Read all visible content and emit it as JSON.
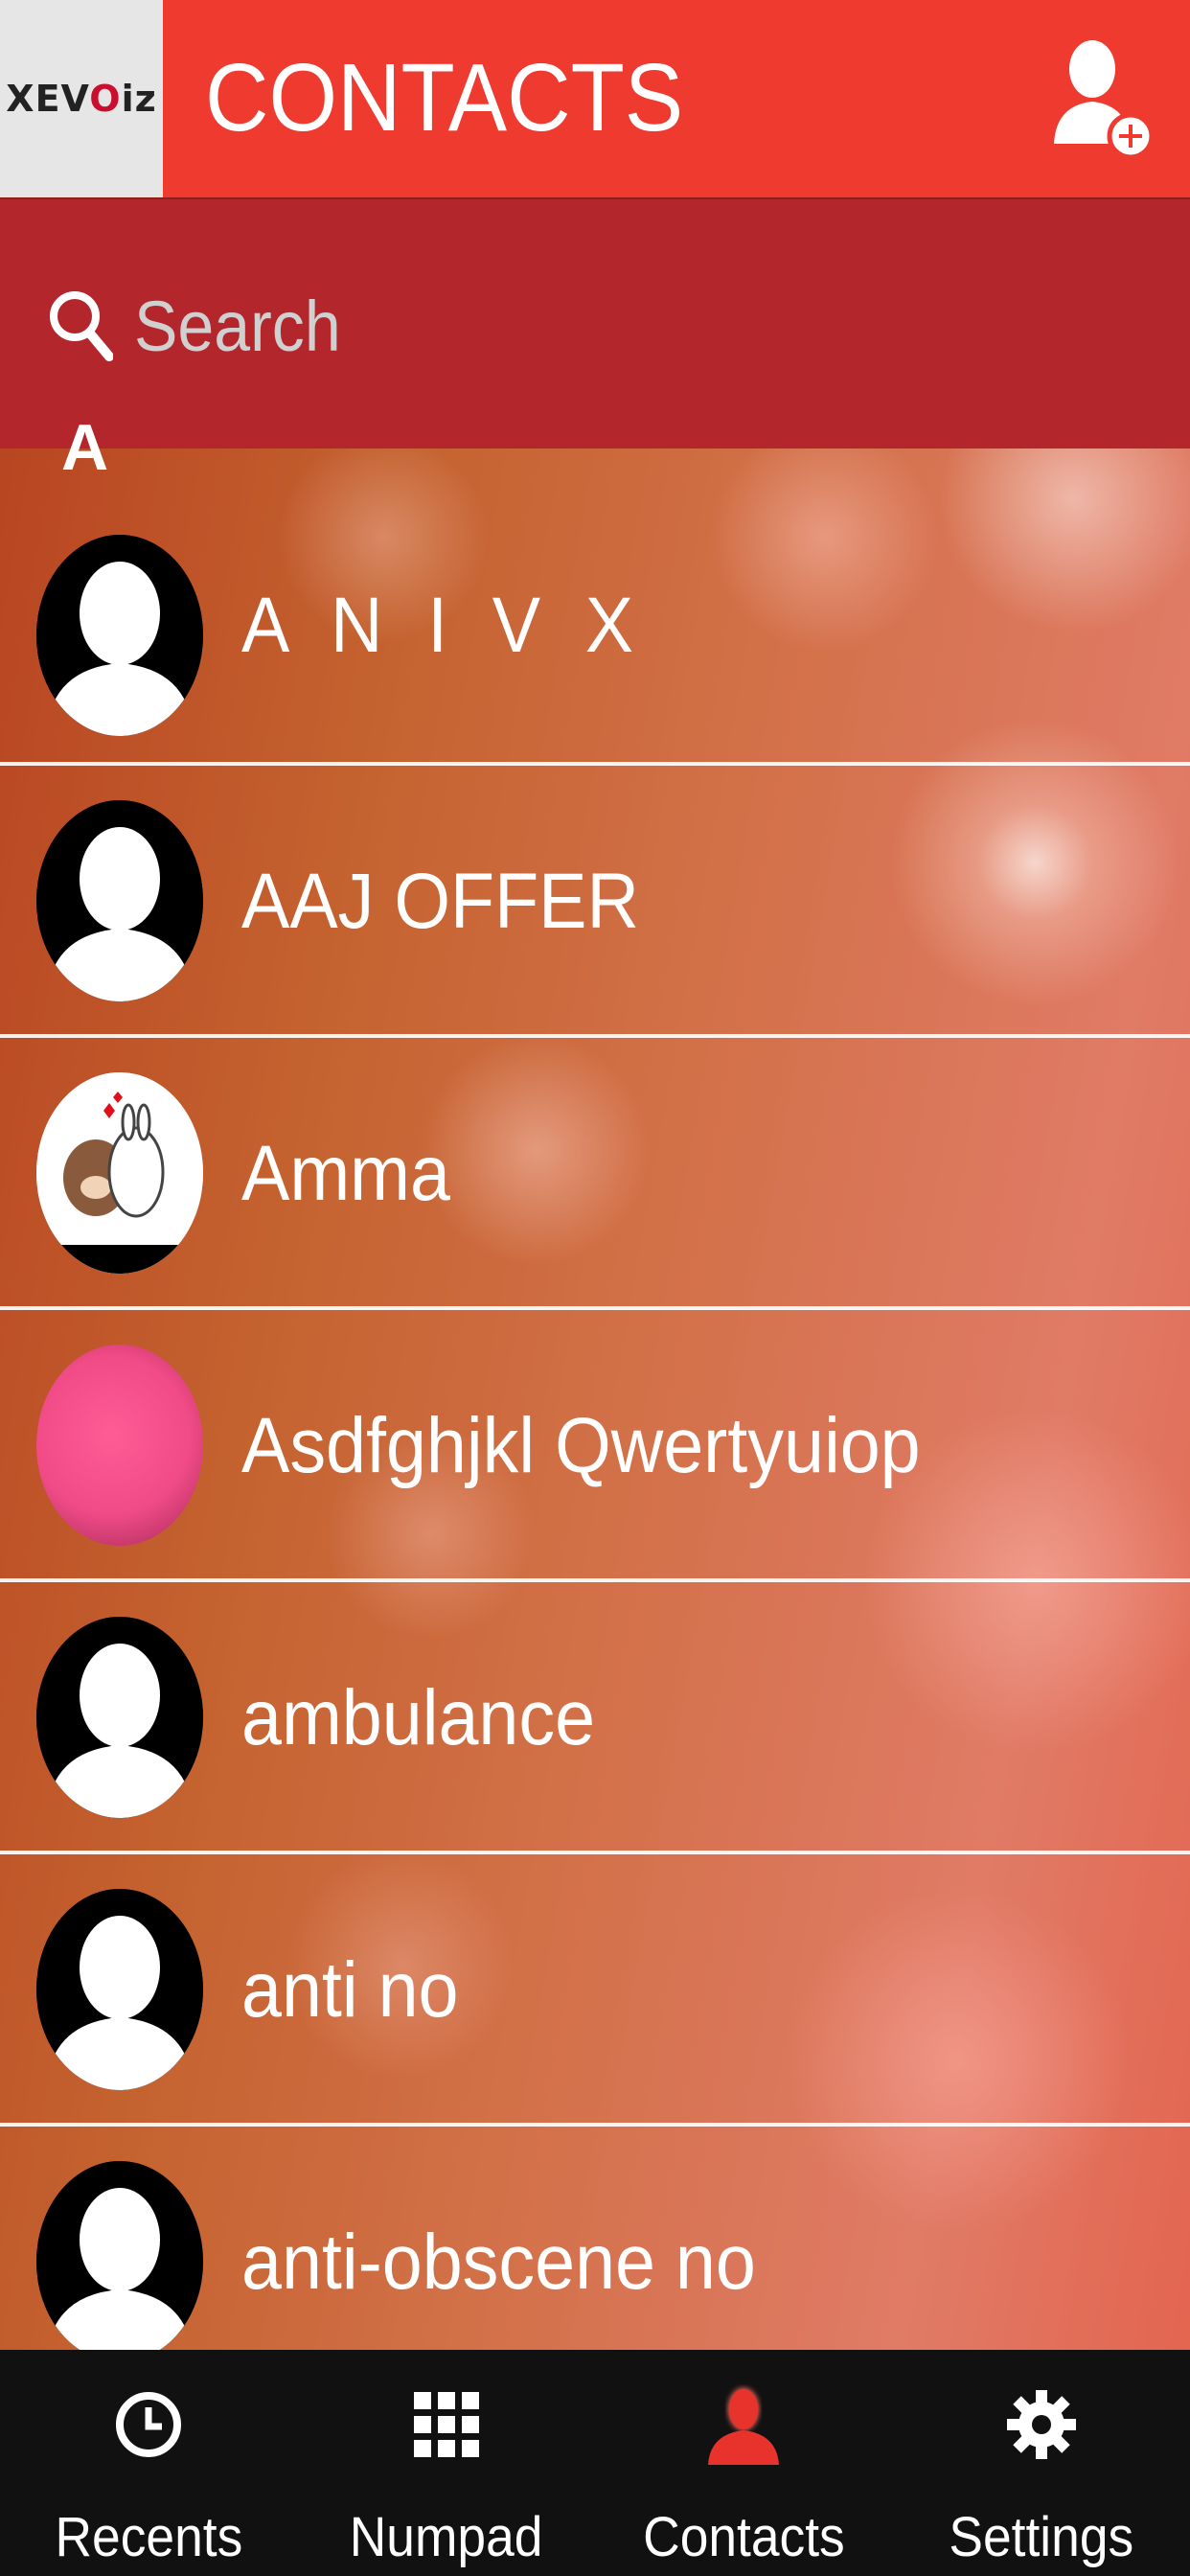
{
  "header": {
    "logo_prefix": "XEV",
    "logo_o": "O",
    "logo_suffix": "iz",
    "title": "CONTACTS",
    "add_contact_icon": "add-contact-icon"
  },
  "search": {
    "placeholder": "Search",
    "icon": "search-icon"
  },
  "section": {
    "letter": "A"
  },
  "contacts": [
    {
      "name": "A N I V X",
      "avatar": "default-avatar"
    },
    {
      "name": "AAJ OFFER",
      "avatar": "default-avatar"
    },
    {
      "name": "Amma",
      "avatar": "sticker-avatar"
    },
    {
      "name": "Asdfghjkl Qwertyuiop",
      "avatar": "pink-avatar"
    },
    {
      "name": "ambulance",
      "avatar": "default-avatar"
    },
    {
      "name": "anti no",
      "avatar": "default-avatar"
    },
    {
      "name": "anti-obscene no",
      "avatar": "default-avatar"
    }
  ],
  "nav": {
    "items": [
      {
        "label": "Recents",
        "icon": "clock-icon",
        "active": false
      },
      {
        "label": "Numpad",
        "icon": "numpad-grid-icon",
        "active": false
      },
      {
        "label": "Contacts",
        "icon": "contact-person-icon",
        "active": true
      },
      {
        "label": "Settings",
        "icon": "gear-icon",
        "active": false
      }
    ]
  },
  "colors": {
    "header_red": "#ee3a2f",
    "search_red": "#b3262c",
    "nav_bg": "#111111",
    "active_icon": "#e8322c"
  }
}
